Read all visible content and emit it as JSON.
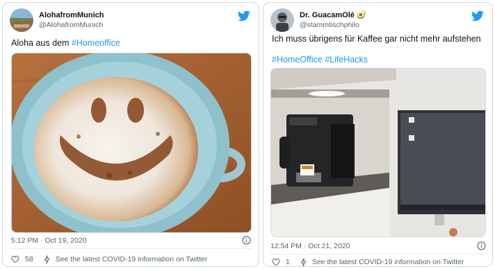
{
  "colors": {
    "brand_blue": "#1d9bf0",
    "text_primary": "#0f1419",
    "text_secondary": "#536471",
    "border": "#cfd9de"
  },
  "tweets": [
    {
      "display_name": "AlohafromMunich",
      "handle": "@AlohafromMunich",
      "verified_emoji": "",
      "text_plain": "Aloha aus dem ",
      "hashtags": [
        "#Homeoffice"
      ],
      "media_description_icon": "cappuccino-photo",
      "timestamp": "5:12 PM · Oct 19, 2020",
      "like_count": "58",
      "covid_text": "See the latest COVID-19 information on Twitter"
    },
    {
      "display_name": "Dr. GuacamOlé",
      "verified_emoji": "🥑",
      "handle": "@stammtischphilo",
      "text_plain": "Ich muss übrigens für Kaffee gar nicht mehr aufstehen",
      "hashtags": [
        "#HomeOffice",
        "#LifeHacks"
      ],
      "media_description_icon": "coffee-machine-photo",
      "timestamp": "12:54 PM · Oct 21, 2020",
      "like_count": "1",
      "covid_text": "See the latest COVID-19 information on Twitter"
    }
  ]
}
